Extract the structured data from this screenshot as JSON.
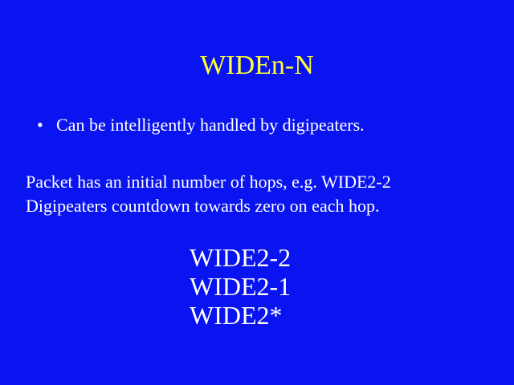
{
  "slide": {
    "title": "WIDEn-N",
    "bullet": {
      "symbol": "•",
      "text": "Can be intelligently handled by digipeaters."
    },
    "paragraph": {
      "line1": "Packet has an initial number of hops, e.g. WIDE2-2",
      "line2": "Digipeaters countdown towards zero on each hop."
    },
    "hop_examples": [
      "WIDE2-2",
      "WIDE2-1",
      "WIDE2*"
    ]
  },
  "colors": {
    "background": "#0a14f0",
    "title": "#ffff33",
    "text": "#ffffff"
  }
}
